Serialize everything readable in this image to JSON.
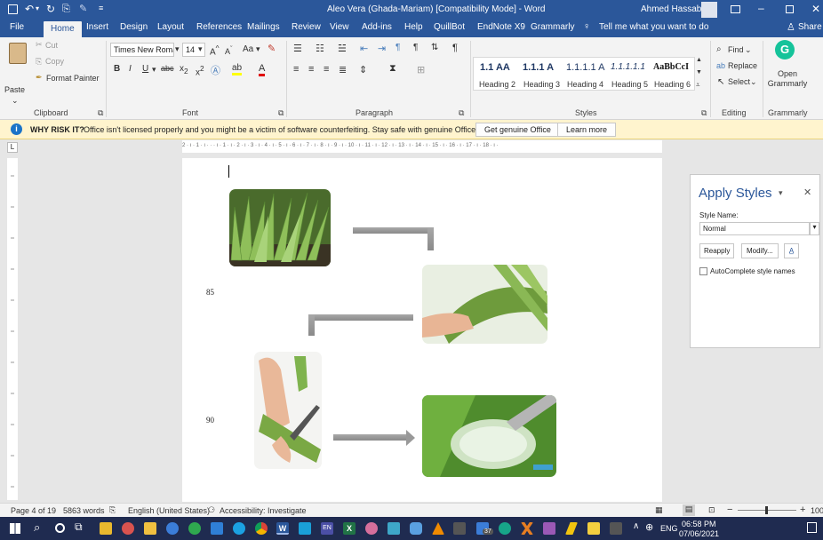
{
  "titlebar": {
    "doc_title": "Aleo Vera (Ghada-Mariam) [Compatibility Mode]  -  Word",
    "user": "Ahmed Hassabo"
  },
  "tabs": [
    "File",
    "Home",
    "Insert",
    "Design",
    "Layout",
    "References",
    "Mailings",
    "Review",
    "View",
    "Add-ins",
    "Help",
    "QuillBot",
    "EndNote X9",
    "Grammarly"
  ],
  "tell_me": "Tell me what you want to do",
  "share": "Share",
  "ribbon": {
    "clipboard": {
      "paste": "Paste",
      "cut": "Cut",
      "copy": "Copy",
      "format_painter": "Format Painter",
      "label": "Clipboard"
    },
    "font": {
      "font_name": "Times New Roma",
      "font_size": "14",
      "change_case": "Aa",
      "label": "Font"
    },
    "paragraph": {
      "label": "Paragraph"
    },
    "styles": {
      "items": [
        {
          "preview": "1.1  AA",
          "name": "Heading 2"
        },
        {
          "preview": "1.1.1  A",
          "name": "Heading 3"
        },
        {
          "preview": "1.1.1.1  A",
          "name": "Heading 4"
        },
        {
          "preview": "1.1.1.1.1",
          "name": "Heading 5"
        },
        {
          "preview": "AaBbCcI",
          "name": "Heading 6"
        }
      ],
      "label": "Styles"
    },
    "editing": {
      "find": "Find",
      "replace": "Replace",
      "select": "Select",
      "label": "Editing"
    },
    "grammarly": {
      "open": "Open Grammarly",
      "label": "Grammarly"
    }
  },
  "warning": {
    "title": "WHY RISK IT?",
    "message": "Office isn't licensed properly and you might be a victim of software counterfeiting. Stay safe with genuine Office today.",
    "btn_genuine": "Get genuine Office",
    "btn_learn": "Learn more"
  },
  "ruler_text": "2 · ı · 1 · ı ·  ·  · ı · 1 · ı · 2 · ı · 3 · ı · 4 · ı · 5 · ı · 6 · ı · 7 · ı · 8 · ı · 9 · ı · 10 · ı · 11 · ı · 12 · ı · 13 · ı · 14 · ı · 15 · ı · 16 · ı · 17 · ı · 18 · ı ·",
  "document": {
    "line_85": "85",
    "line_90": "90"
  },
  "apply_styles": {
    "title": "Apply Styles",
    "style_name_label": "Style Name:",
    "style_value": "Normal",
    "reapply": "Reapply",
    "modify": "Modify...",
    "autocomplete": "AutoComplete style names"
  },
  "status": {
    "page": "Page 4 of 19",
    "words": "5863 words",
    "language": "English (United States)",
    "accessibility": "Accessibility: Investigate",
    "zoom": "100"
  },
  "taskbar": {
    "lang": "ENG",
    "time": "06:58 PM",
    "date": "07/06/2021",
    "badge": "37"
  },
  "colors": {
    "word_blue": "#2b579a",
    "grammarly_green": "#15c39a"
  }
}
